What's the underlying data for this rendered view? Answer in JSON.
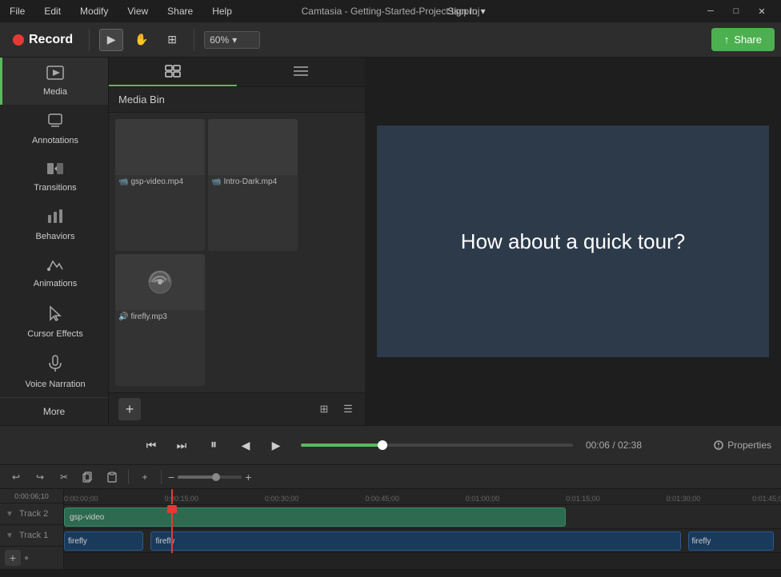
{
  "app": {
    "title": "Camtasia - Getting-Started-Project.tscproj"
  },
  "menubar": {
    "items": [
      "File",
      "Edit",
      "Modify",
      "View",
      "Share",
      "Help"
    ],
    "signIn": "Sign In"
  },
  "toolbar": {
    "record_label": "Record",
    "zoom_value": "60%",
    "share_label": "Share"
  },
  "sidebar": {
    "items": [
      {
        "id": "media",
        "label": "Media",
        "icon": "🎬"
      },
      {
        "id": "annotations",
        "label": "Annotations",
        "icon": "📝"
      },
      {
        "id": "transitions",
        "label": "Transitions",
        "icon": "🔄"
      },
      {
        "id": "behaviors",
        "label": "Behaviors",
        "icon": "⚡"
      },
      {
        "id": "animations",
        "label": "Animations",
        "icon": "🎯"
      },
      {
        "id": "cursor-effects",
        "label": "Cursor Effects",
        "icon": "🖱️"
      },
      {
        "id": "voice-narration",
        "label": "Voice Narration",
        "icon": "🎙️"
      }
    ],
    "more_label": "More"
  },
  "media_panel": {
    "tabs": [
      "grid-view",
      "list-view"
    ],
    "header": "Media Bin",
    "items": [
      {
        "name": "gsp-video.mp4",
        "type": "video",
        "icon": "📹"
      },
      {
        "name": "Intro-Dark.mp4",
        "type": "video",
        "icon": "📹"
      },
      {
        "name": "firefly.mp3",
        "type": "audio",
        "icon": "🔊"
      }
    ]
  },
  "preview": {
    "text": "How about a quick tour?"
  },
  "transport": {
    "current_time": "00:06",
    "total_time": "02:38",
    "separator": "/",
    "properties_label": "Properties"
  },
  "timeline": {
    "tracks": [
      {
        "id": "track2",
        "label": "Track 2",
        "clips": [
          {
            "name": "gsp-video",
            "type": "video",
            "left": "0%",
            "width": "70%"
          }
        ]
      },
      {
        "id": "track1",
        "label": "Track 1",
        "clips": [
          {
            "name": "firefly",
            "type": "audio",
            "left": "0%",
            "width": "12%"
          },
          {
            "name": "firefly",
            "type": "audio",
            "left": "13%",
            "width": "72%"
          },
          {
            "name": "firefly",
            "type": "audio",
            "left": "86%",
            "width": "13%"
          }
        ]
      }
    ],
    "ruler_marks": [
      "0:00:00;00",
      "0:00:15;00",
      "0:00:30;00",
      "0:00:45;00",
      "0:01:00;00",
      "0:01:15;00",
      "0:01:30;00",
      "0:01:45;00"
    ],
    "playhead_time": "0:00:06;10"
  }
}
